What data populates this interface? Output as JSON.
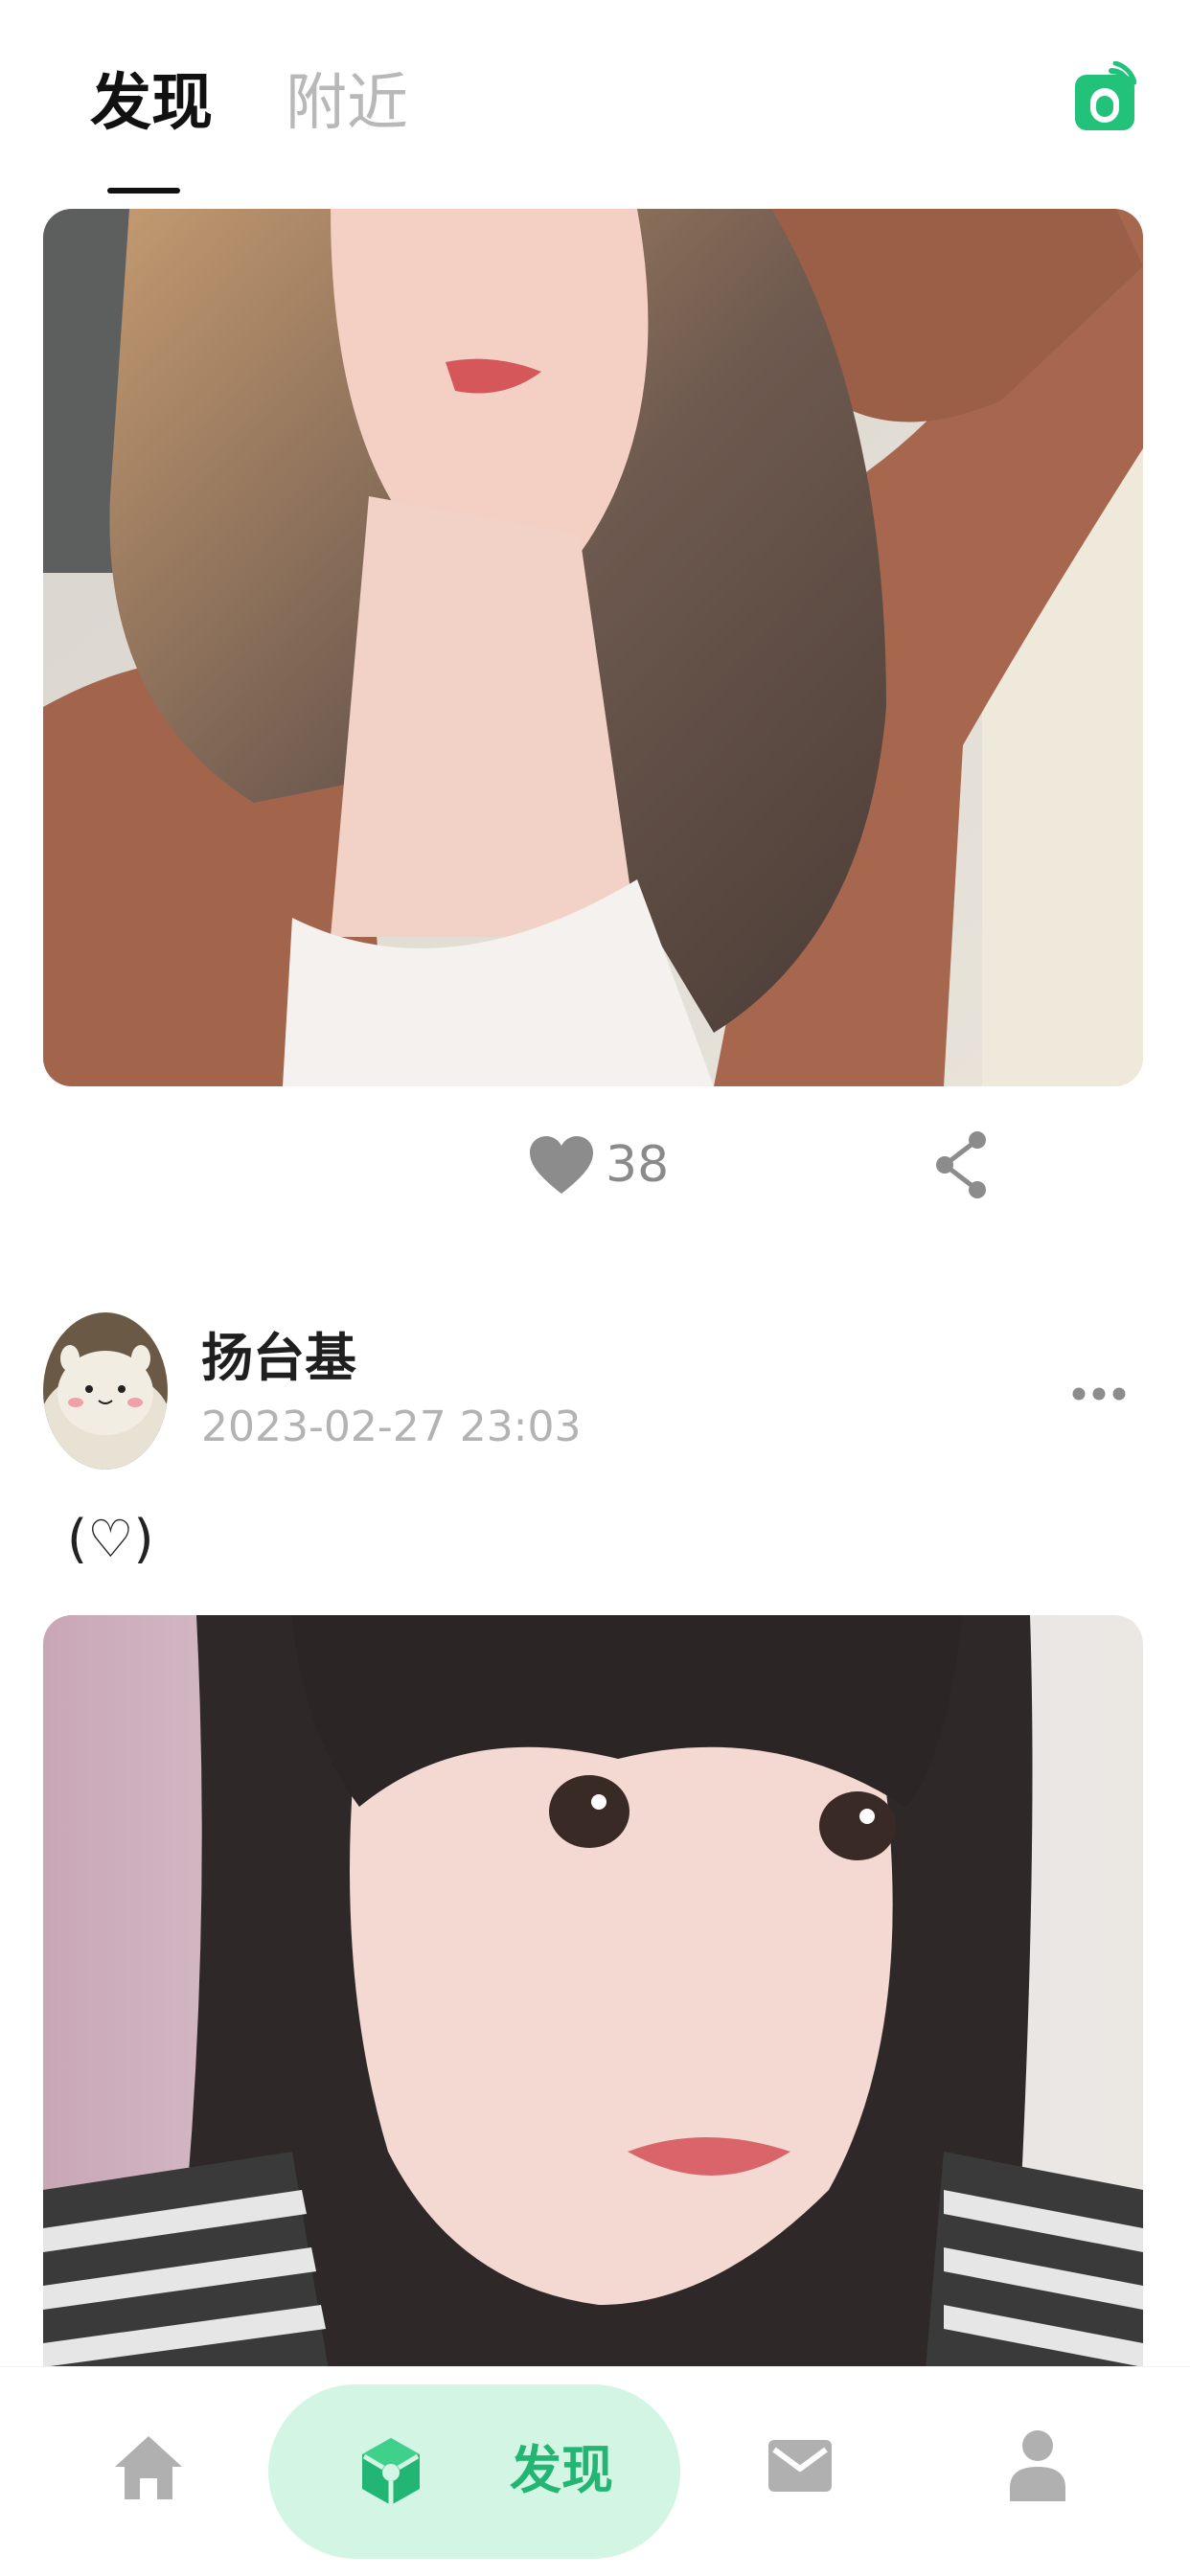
{
  "header": {
    "tabs": [
      {
        "label": "发现",
        "active": true
      },
      {
        "label": "附近",
        "active": false
      }
    ],
    "camera_icon": "camera-icon",
    "accent_color": "#22c27a"
  },
  "feed": {
    "posts": [
      {
        "image_icon": "photo",
        "likes": "38",
        "like_icon": "heart-icon",
        "share_icon": "share-icon"
      },
      {
        "author": "扬台基",
        "timestamp": "2023-02-27 23:03",
        "caption": "(♡)",
        "more_icon": "more-dots-icon",
        "image_icon": "photo"
      }
    ]
  },
  "bottom_nav": {
    "items": [
      {
        "icon": "home-icon",
        "label": "",
        "active": false
      },
      {
        "icon": "discover-cube-icon",
        "label": "发现",
        "active": true
      },
      {
        "icon": "mail-icon",
        "label": "",
        "active": false
      },
      {
        "icon": "person-icon",
        "label": "",
        "active": false
      }
    ],
    "active_color": "#22b573",
    "active_bg": "#d3f5e4",
    "inactive_color": "#b0b0b0"
  }
}
